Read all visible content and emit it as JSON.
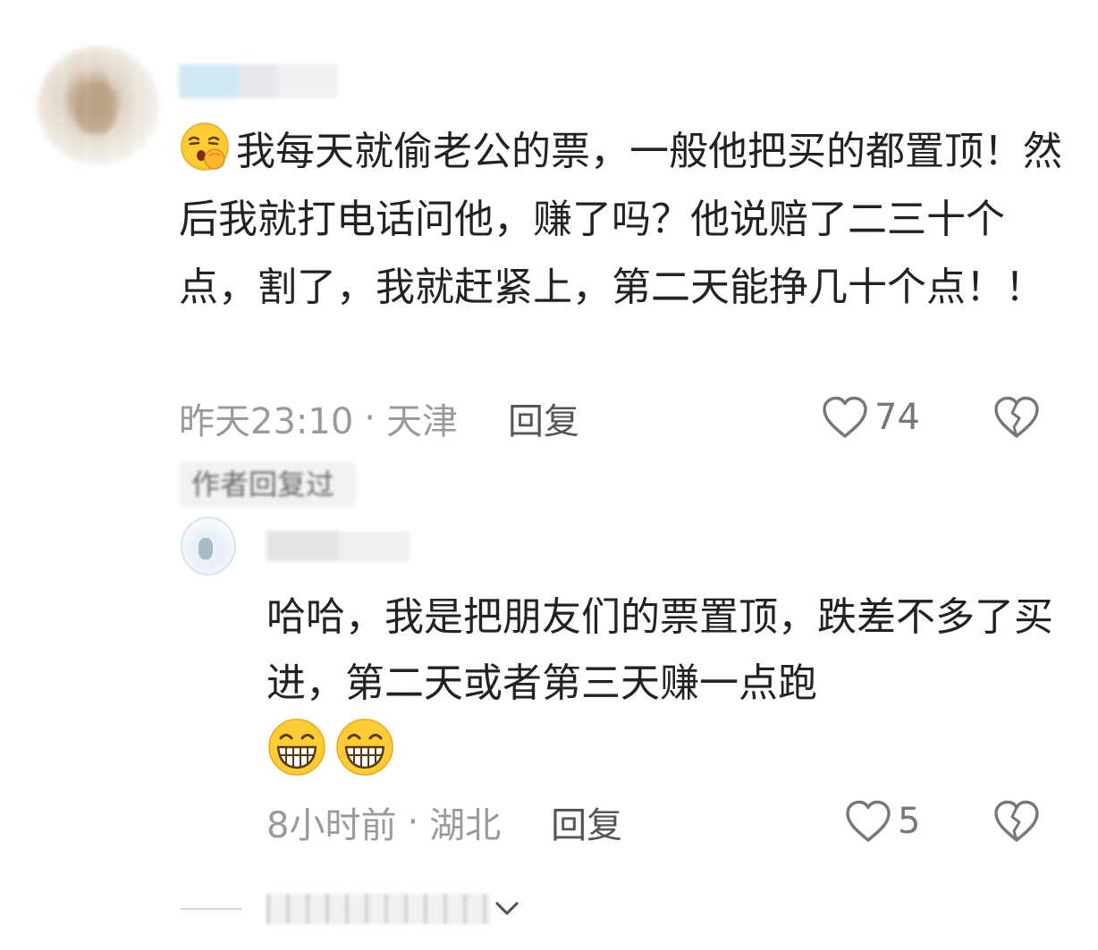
{
  "main_comment": {
    "text": "我每天就偷老公的票，一般他把买的都置顶！然后我就打电话问他，赚了吗？他说赔了二三十个点，割了，我就赶紧上，第二天能挣几十个点！！",
    "emoji_icon": "sleepy-face-emoji-icon",
    "time": "昨天23:10",
    "separator": "·",
    "location": "天津",
    "reply_label": "回复",
    "like_count": "74"
  },
  "author_badge": {
    "label": "作者回复过"
  },
  "reply_comment": {
    "text": "哈哈，我是把朋友们的票置顶，跌差不多了买进，第二天或者第三天赚一点跑",
    "emoji_icons": [
      "grinning-face-emoji-icon",
      "grinning-face-emoji-icon"
    ],
    "time": "8小时前",
    "separator": "·",
    "location": "湖北",
    "reply_label": "回复",
    "like_count": "5"
  },
  "colors": {
    "text_primary": "#222222",
    "text_meta": "#9a9a9a",
    "reply_button": "#555555",
    "icon_stroke": "#777777"
  }
}
